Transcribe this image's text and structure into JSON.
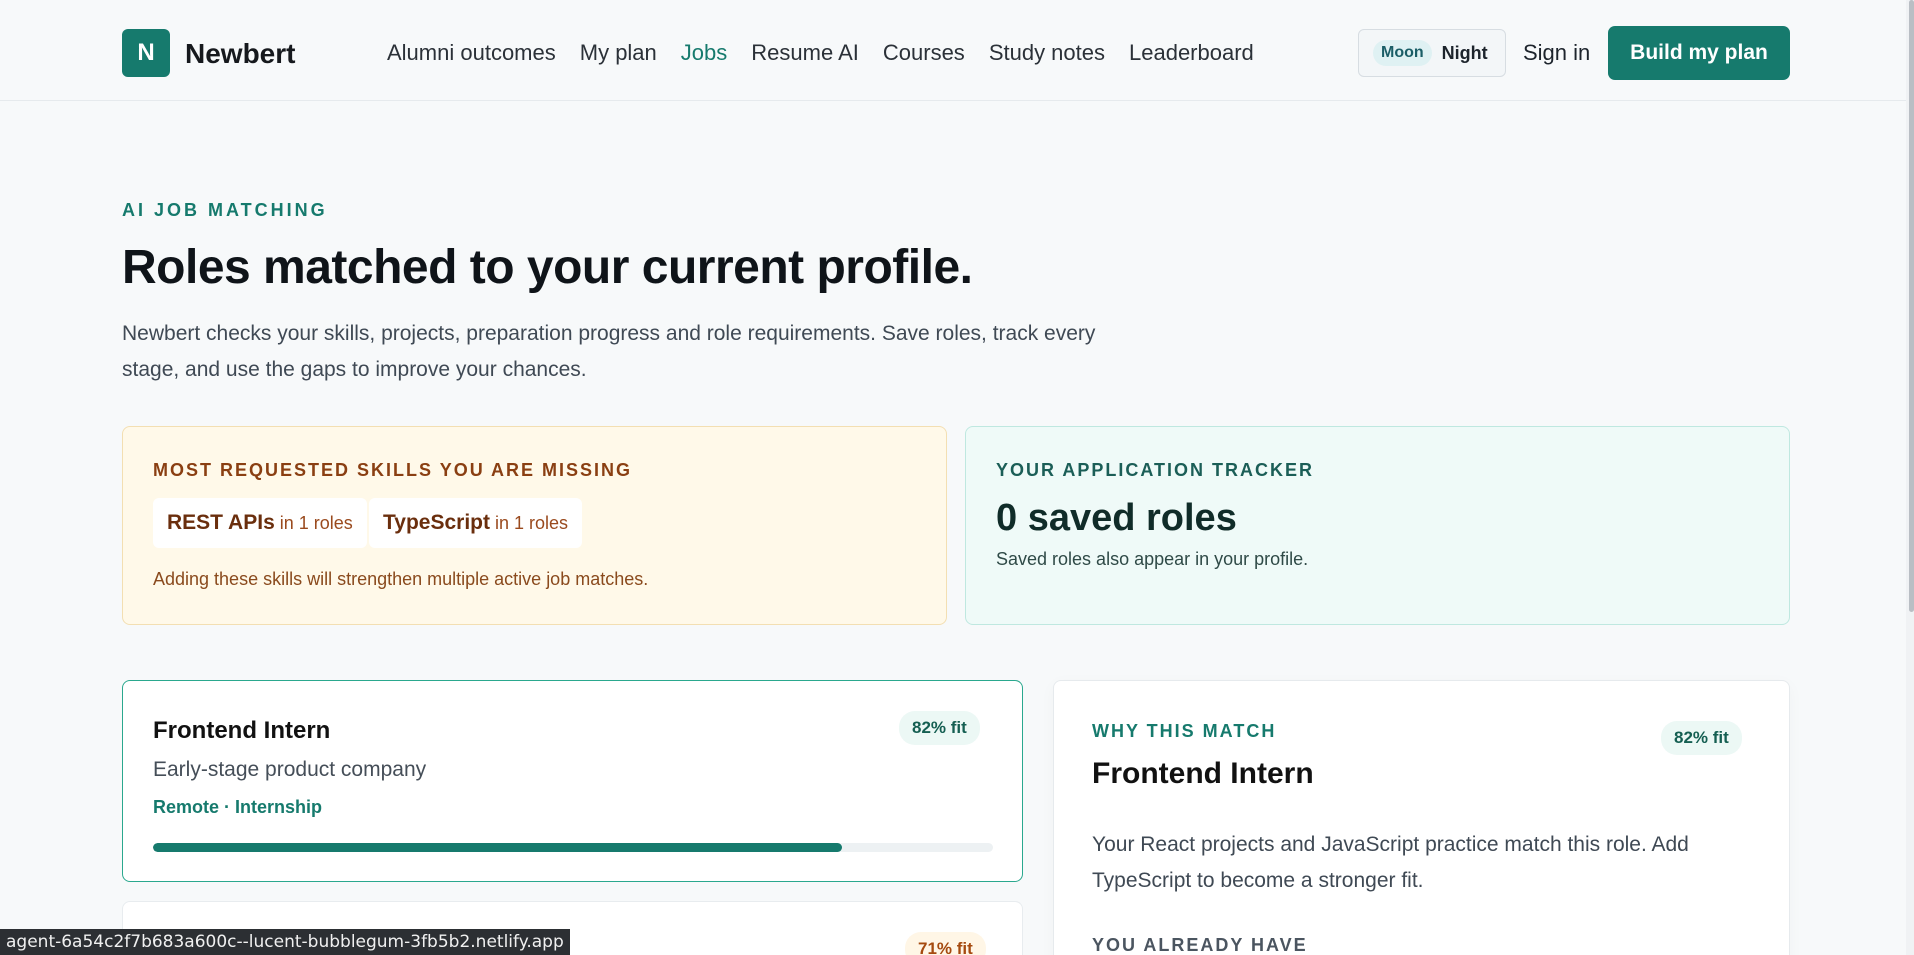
{
  "header": {
    "logo_letter": "N",
    "brand": "Newbert",
    "nav": [
      "Alumni outcomes",
      "My plan",
      "Jobs",
      "Resume AI",
      "Courses",
      "Study notes",
      "Leaderboard"
    ],
    "active_nav": "Jobs",
    "theme_moon": "Moon",
    "theme_night": "Night",
    "signin": "Sign in",
    "build_button": "Build my plan"
  },
  "hero": {
    "eyebrow": "AI JOB MATCHING",
    "title": "Roles matched to your current profile.",
    "description": "Newbert checks your skills, projects, preparation progress and role requirements. Save roles, track every stage, and use the gaps to improve your chances."
  },
  "skills_card": {
    "label": "MOST REQUESTED SKILLS YOU ARE MISSING",
    "skills": [
      {
        "name": "REST APIs",
        "count": "in 1 roles"
      },
      {
        "name": "TypeScript",
        "count": "in 1 roles"
      }
    ],
    "note": "Adding these skills will strengthen multiple active job matches."
  },
  "tracker_card": {
    "label": "YOUR APPLICATION TRACKER",
    "count": "0 saved roles",
    "sub": "Saved roles also appear in your profile."
  },
  "jobs": [
    {
      "title": "Frontend Intern",
      "fit": "82% fit",
      "company": "Early-stage product company",
      "meta": "Remote · Internship",
      "progress": 0.82
    },
    {
      "fit": "71% fit"
    }
  ],
  "why": {
    "label": "WHY THIS MATCH",
    "fit": "82% fit",
    "title": "Frontend Intern",
    "description": "Your React projects and JavaScript practice match this role. Add TypeScript to become a stronger fit.",
    "have_label": "YOU ALREADY HAVE"
  },
  "status_url": "agent-6a54c2f7b683a600c--lucent-bubblegum-3fb5b2.netlify.app",
  "colors": {
    "brand": "#167a6d",
    "skills_bg": "#fff9e9",
    "tracker_bg": "#effaf8"
  }
}
